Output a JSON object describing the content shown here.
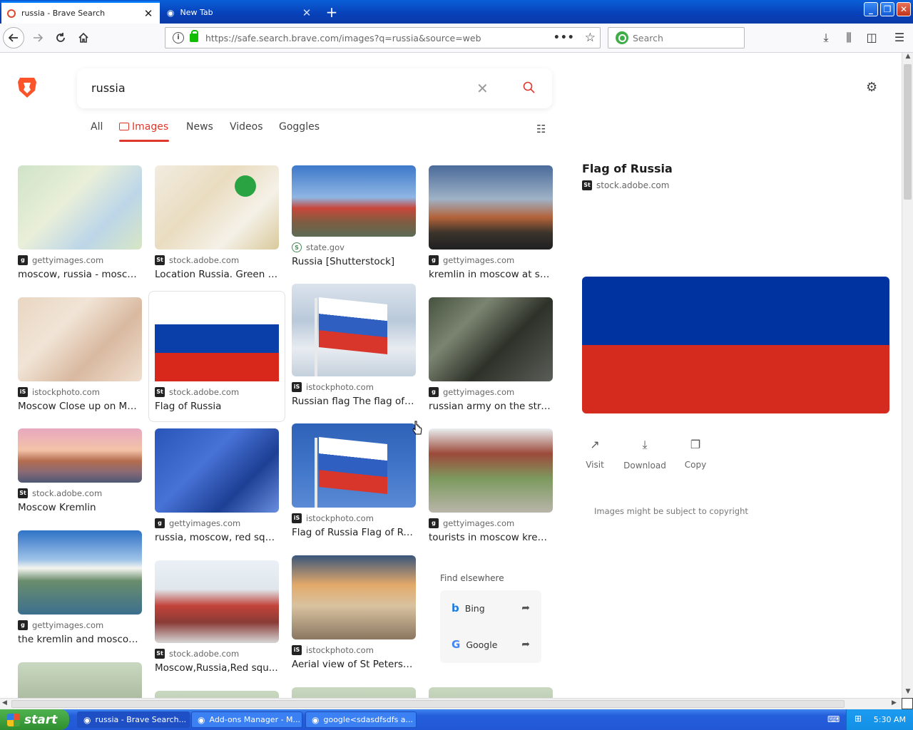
{
  "browser": {
    "tabs": [
      {
        "title": "russia - Brave Search",
        "close": "✕"
      },
      {
        "title": "New Tab",
        "close": "✕"
      }
    ],
    "new_tab": "+",
    "window_buttons": {
      "minimize": "_",
      "maximize": "❐",
      "close": "✕"
    },
    "url": "https://safe.search.brave.com/images?q=russia&source=web",
    "search_placeholder": "Search",
    "more_icon": "•••",
    "star_icon": "☆"
  },
  "search": {
    "query": "russia",
    "clear_icon": "✕"
  },
  "nav_tabs": [
    "All",
    "Images",
    "News",
    "Videos",
    "Goggles"
  ],
  "results": [
    {
      "source": "gettyimages.com",
      "badge": "g",
      "caption": "moscow, russia - mosco...",
      "thumb": "map-moscow"
    },
    {
      "source": "stock.adobe.com",
      "badge": "St",
      "caption": "Location Russia. Green p...",
      "thumb": "map-pin"
    },
    {
      "source": "state.gov",
      "badge": "S",
      "caption": "Russia [Shutterstock]",
      "thumb": "kremlin-day"
    },
    {
      "source": "gettyimages.com",
      "badge": "g",
      "caption": "kremlin in moscow at su...",
      "thumb": "kremlin-sunset"
    },
    {
      "source": "istockphoto.com",
      "badge": "iS",
      "caption": "Moscow Close up on Mo...",
      "thumb": "map-old"
    },
    {
      "source": "stock.adobe.com",
      "badge": "St",
      "caption": "Flag of Russia",
      "thumb": "flag-flat"
    },
    {
      "source": "istockphoto.com",
      "badge": "iS",
      "caption": "Russian flag The flag of ...",
      "thumb": "flag-wave-cloud"
    },
    {
      "source": "gettyimages.com",
      "badge": "g",
      "caption": "russian army on the stre...",
      "thumb": "army"
    },
    {
      "source": "stock.adobe.com",
      "badge": "St",
      "caption": "Moscow Kremlin",
      "thumb": "kremlin-river-pink"
    },
    {
      "source": "gettyimages.com",
      "badge": "g",
      "caption": "russia, moscow, red squ...",
      "thumb": "blue-square"
    },
    {
      "source": "istockphoto.com",
      "badge": "iS",
      "caption": "Flag of Russia Flag of Ru...",
      "thumb": "flag-blue-sky"
    },
    {
      "source": "gettyimages.com",
      "badge": "g",
      "caption": "tourists in moscow kreml...",
      "thumb": "tourists"
    },
    {
      "source": "gettyimages.com",
      "badge": "g",
      "caption": "the kremlin and moscow...",
      "thumb": "kremlin-river-day"
    },
    {
      "source": "stock.adobe.com",
      "badge": "St",
      "caption": "Moscow,Russia,Red squ...",
      "thumb": "basil"
    },
    {
      "source": "istockphoto.com",
      "badge": "iS",
      "caption": "Aerial view of St Petersb...",
      "thumb": "petersburg"
    }
  ],
  "find_elsewhere": {
    "title": "Find elsewhere",
    "items": [
      {
        "name": "Bing",
        "icon": "b"
      },
      {
        "name": "Google",
        "icon": "G"
      }
    ]
  },
  "preview": {
    "title": "Flag of Russia",
    "source": "stock.adobe.com",
    "source_badge": "St",
    "flag_colors": [
      "#0033a0",
      "#d52b1e"
    ],
    "actions": [
      {
        "label": "Visit",
        "icon": "↗"
      },
      {
        "label": "Download",
        "icon": "⤓"
      },
      {
        "label": "Copy",
        "icon": "❐"
      }
    ],
    "copyright": "Images might be subject to copyright"
  },
  "taskbar": {
    "start": "start",
    "tasks": [
      {
        "title": "russia - Brave Search..."
      },
      {
        "title": "Add-ons Manager - M..."
      },
      {
        "title": "google<sdasdfsdfs a..."
      }
    ],
    "clock": "5:30 AM"
  },
  "colors": {
    "accent": "#e0372c",
    "brand": "#fb542b"
  }
}
